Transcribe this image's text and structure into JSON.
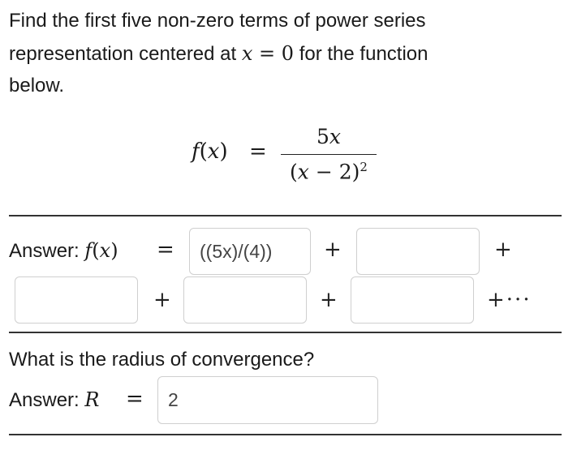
{
  "question": {
    "line1": "Find the first five non-zero terms of power series",
    "line2_before": "representation centered at ",
    "line2_var": "x",
    "line2_eq": " = 0",
    "line2_after": " for the function",
    "line3": "below."
  },
  "formula": {
    "lhs_f": "f",
    "lhs_open": "(",
    "lhs_x": "x",
    "lhs_close": ")",
    "equals": "=",
    "numerator_num": "5",
    "numerator_var": "x",
    "denominator_open": "(",
    "denominator_var": "x",
    "denominator_rest": " − 2)",
    "denominator_exp": "2"
  },
  "answer1": {
    "label": "Answer: ",
    "f": "f",
    "open": "(",
    "x": "x",
    "close": ")",
    "equals": "=",
    "plus": "+",
    "ellipsis": "+···",
    "term1_value": "((5x)/(4))",
    "term2_value": "",
    "term3_value": "",
    "term4_value": "",
    "term5_value": ""
  },
  "question2": "What is the radius of convergence?",
  "answer2": {
    "label": "Answer: ",
    "var": "R",
    "equals": "=",
    "value": "2"
  }
}
